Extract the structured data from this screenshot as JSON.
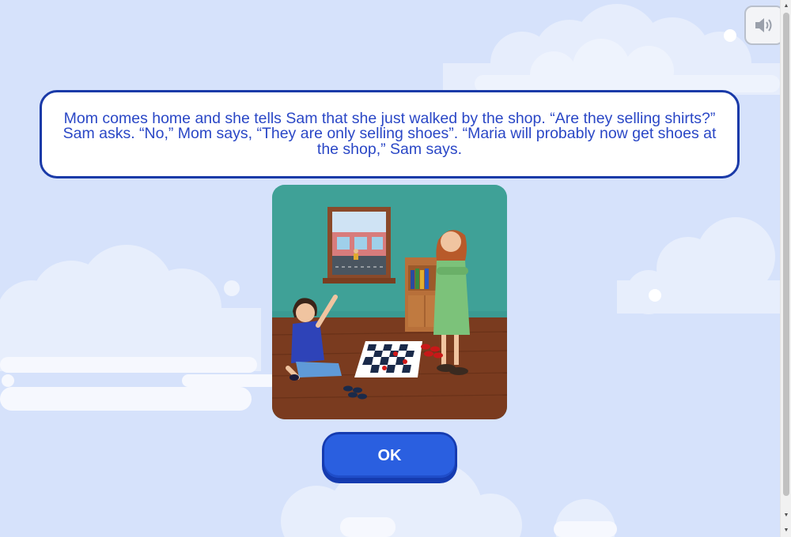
{
  "story": {
    "text": "Mom comes home and she tells Sam that she just walked by the shop. “Are they selling shirts?” Sam asks. “No,” Mom says, “They are only selling shoes”. “Maria will probably now get shoes at the shop,” Sam says."
  },
  "buttons": {
    "ok_label": "OK"
  },
  "icons": {
    "sound": "speaker-icon"
  },
  "colors": {
    "background": "#d6e2fb",
    "box_border": "#1a3aa8",
    "story_text": "#2a47c6",
    "ok_button": "#2a5fe0"
  }
}
